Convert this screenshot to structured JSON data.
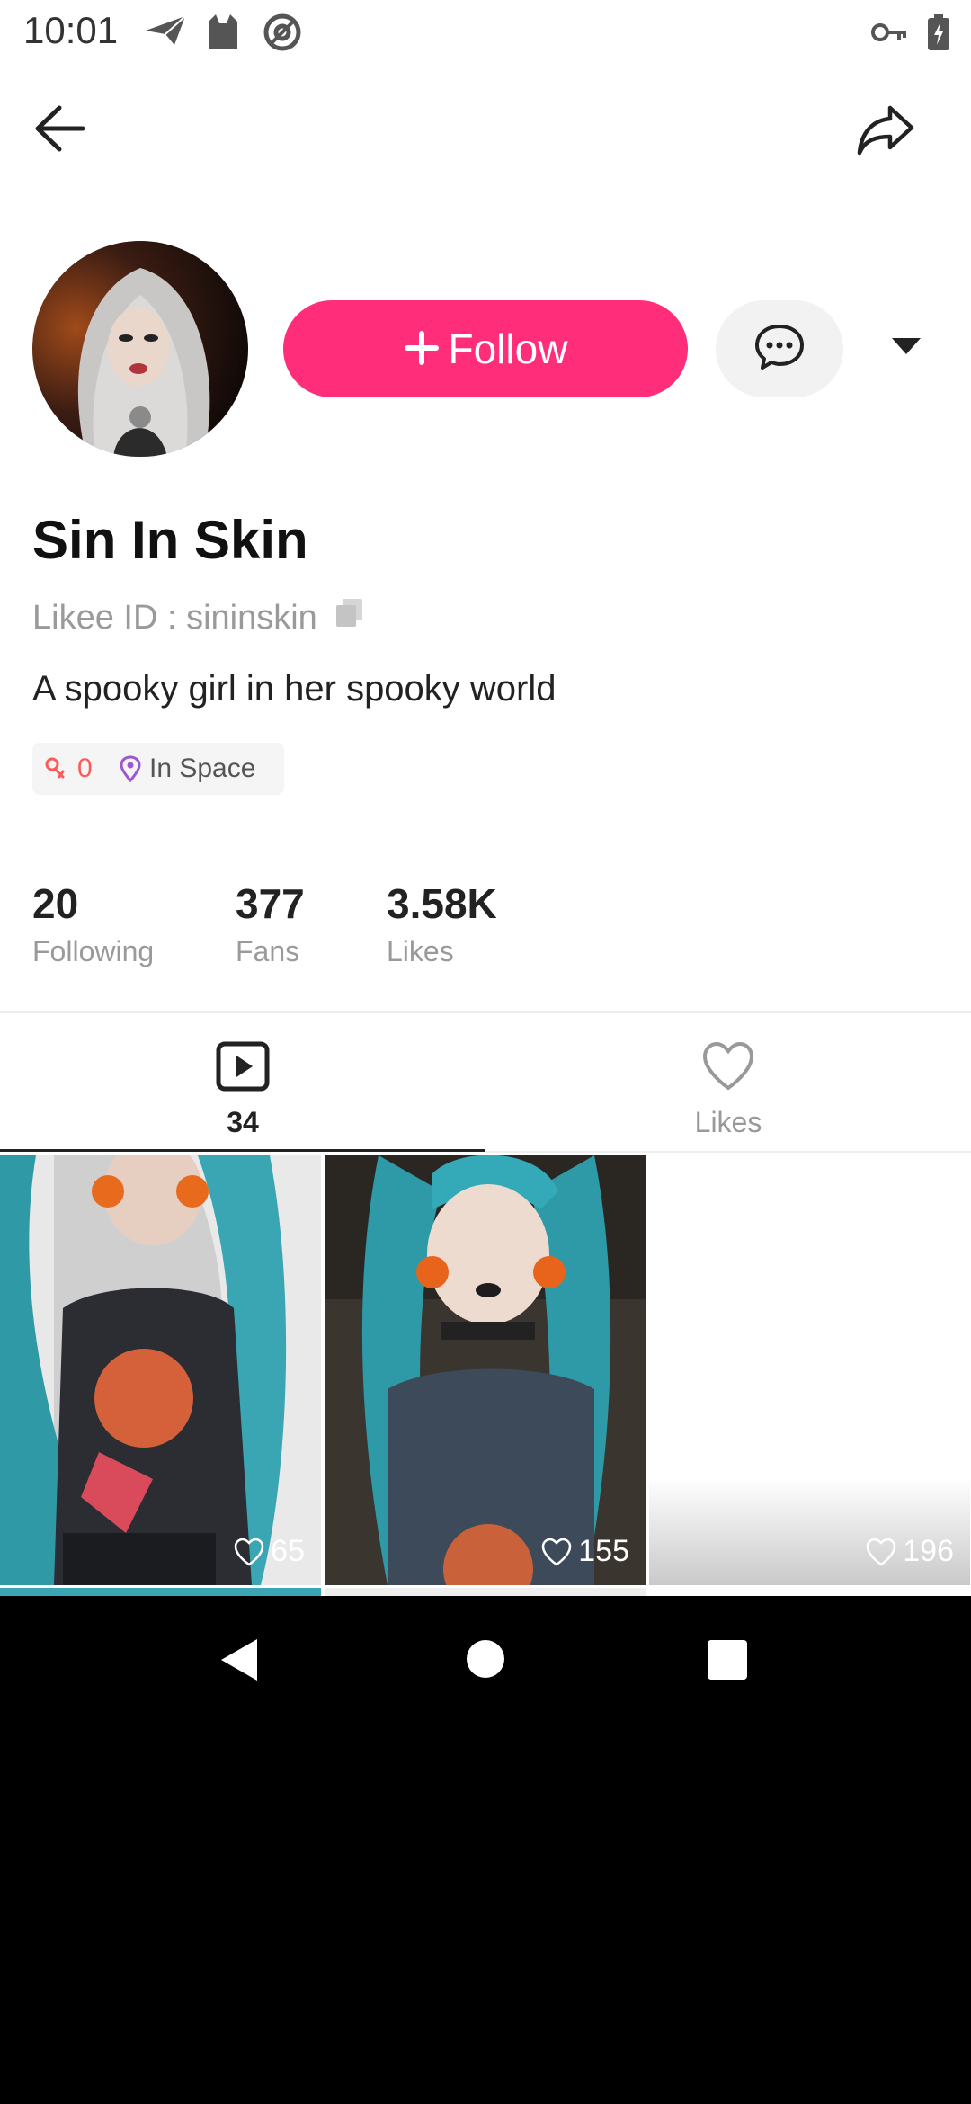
{
  "status_bar": {
    "time": "10:01"
  },
  "profile": {
    "name": "Sin In Skin",
    "likee_id": "Likee ID : sininskin",
    "bio": "A spooky girl in her spooky world",
    "follow_label": "Follow",
    "tags": [
      {
        "text": "0",
        "icon": "people-icon",
        "color": "#ff5a5a"
      },
      {
        "text": "In Space",
        "icon": "location-pin-icon",
        "color": "#9b59d0"
      }
    ],
    "accent_color": "#ff2d7a"
  },
  "stats": [
    {
      "value": "20",
      "label": "Following"
    },
    {
      "value": "377",
      "label": "Fans"
    },
    {
      "value": "3.58K",
      "label": "Likes"
    }
  ],
  "tabs": [
    {
      "label": "34",
      "icon": "video-play-icon",
      "active": true
    },
    {
      "label": "Likes",
      "icon": "heart-icon",
      "active": false
    }
  ],
  "videos": [
    {
      "likes": "65"
    },
    {
      "likes": "155"
    },
    {
      "likes": "196"
    }
  ]
}
